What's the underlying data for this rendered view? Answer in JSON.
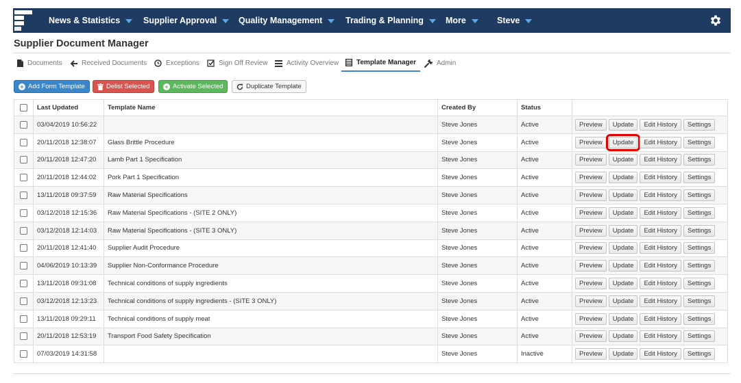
{
  "nav": {
    "items": [
      {
        "label": "News & Statistics"
      },
      {
        "label": "Supplier Approval"
      },
      {
        "label": "Quality Management"
      },
      {
        "label": "Trading & Planning"
      },
      {
        "label": "More"
      },
      {
        "label": "Steve"
      }
    ],
    "icons": {
      "logo": "app-logo",
      "settings": "gear-icon",
      "dropdown": "caret-down-icon"
    },
    "colors": {
      "bar": "#1f3b61",
      "caret": "#5fa8e6"
    }
  },
  "page": {
    "title": "Supplier Document Manager"
  },
  "tabs": [
    {
      "label": "Documents",
      "icon": "document-icon"
    },
    {
      "label": "Received Documents",
      "icon": "arrow-left-icon"
    },
    {
      "label": "Exceptions",
      "icon": "clock-icon"
    },
    {
      "label": "Sign Off Review",
      "icon": "checkbox-icon"
    },
    {
      "label": "Activity Overview",
      "icon": "list-icon"
    },
    {
      "label": "Template Manager",
      "icon": "table-icon",
      "active": true
    },
    {
      "label": "Admin",
      "icon": "wrench-icon"
    }
  ],
  "toolbar": {
    "add": "Add Form Template",
    "delist": "Delist Selected",
    "activate": "Activate Selected",
    "duplicate": "Duplicate Template",
    "colors": {
      "blue": "#3a86c8",
      "red": "#d9534f",
      "green": "#5cb85c"
    }
  },
  "table": {
    "headers": {
      "last_updated": "Last Updated",
      "template_name": "Template Name",
      "created_by": "Created By",
      "status": "Status"
    },
    "actions": {
      "preview": "Preview",
      "update": "Update",
      "edit_history": "Edit History",
      "settings": "Settings"
    },
    "rows": [
      {
        "updated": "03/04/2019 10:56:22",
        "name": "",
        "by": "Steve Jones",
        "status": "Active"
      },
      {
        "updated": "20/11/2018 12:38:07",
        "name": "Glass Brittle Procedure",
        "by": "Steve Jones",
        "status": "Active",
        "highlight_update": true
      },
      {
        "updated": "20/11/2018 12:47:20",
        "name": "Lamb Part 1 Specification",
        "by": "Steve Jones",
        "status": "Active"
      },
      {
        "updated": "20/11/2018 12:44:02",
        "name": "Pork Part 1 Specification",
        "by": "Steve Jones",
        "status": "Active"
      },
      {
        "updated": "13/11/2018 09:37:59",
        "name": "Raw Material Specifications",
        "by": "Steve Jones",
        "status": "Active"
      },
      {
        "updated": "03/12/2018 12:15:36",
        "name": "Raw Material Specifications - (SITE 2 ONLY)",
        "by": "Steve Jones",
        "status": "Active"
      },
      {
        "updated": "03/12/2018 12:14:03",
        "name": "Raw Material Specifications - (SITE 3 ONLY)",
        "by": "Steve Jones",
        "status": "Active"
      },
      {
        "updated": "20/11/2018 12:41:40",
        "name": "Supplier Audit Procedure",
        "by": "Steve Jones",
        "status": "Active"
      },
      {
        "updated": "04/06/2019 10:13:39",
        "name": "Supplier Non-Conformance Procedure",
        "by": "Steve Jones",
        "status": "Active"
      },
      {
        "updated": "13/11/2018 09:31:08",
        "name": "Technical conditions of supply ingredients",
        "by": "Steve Jones",
        "status": "Active"
      },
      {
        "updated": "03/12/2018 12:13:23",
        "name": "Technical conditions of supply ingredients - (SITE 3 ONLY)",
        "by": "Steve Jones",
        "status": "Active"
      },
      {
        "updated": "13/11/2018 09:29:11",
        "name": "Technical conditions of supply meat",
        "by": "Steve Jones",
        "status": "Active"
      },
      {
        "updated": "20/11/2018 12:53:19",
        "name": "Transport Food Safety Specification",
        "by": "Steve Jones",
        "status": "Active"
      },
      {
        "updated": "07/03/2019 14:31:58",
        "name": "",
        "by": "Steve Jones",
        "status": "Inactive"
      }
    ]
  }
}
